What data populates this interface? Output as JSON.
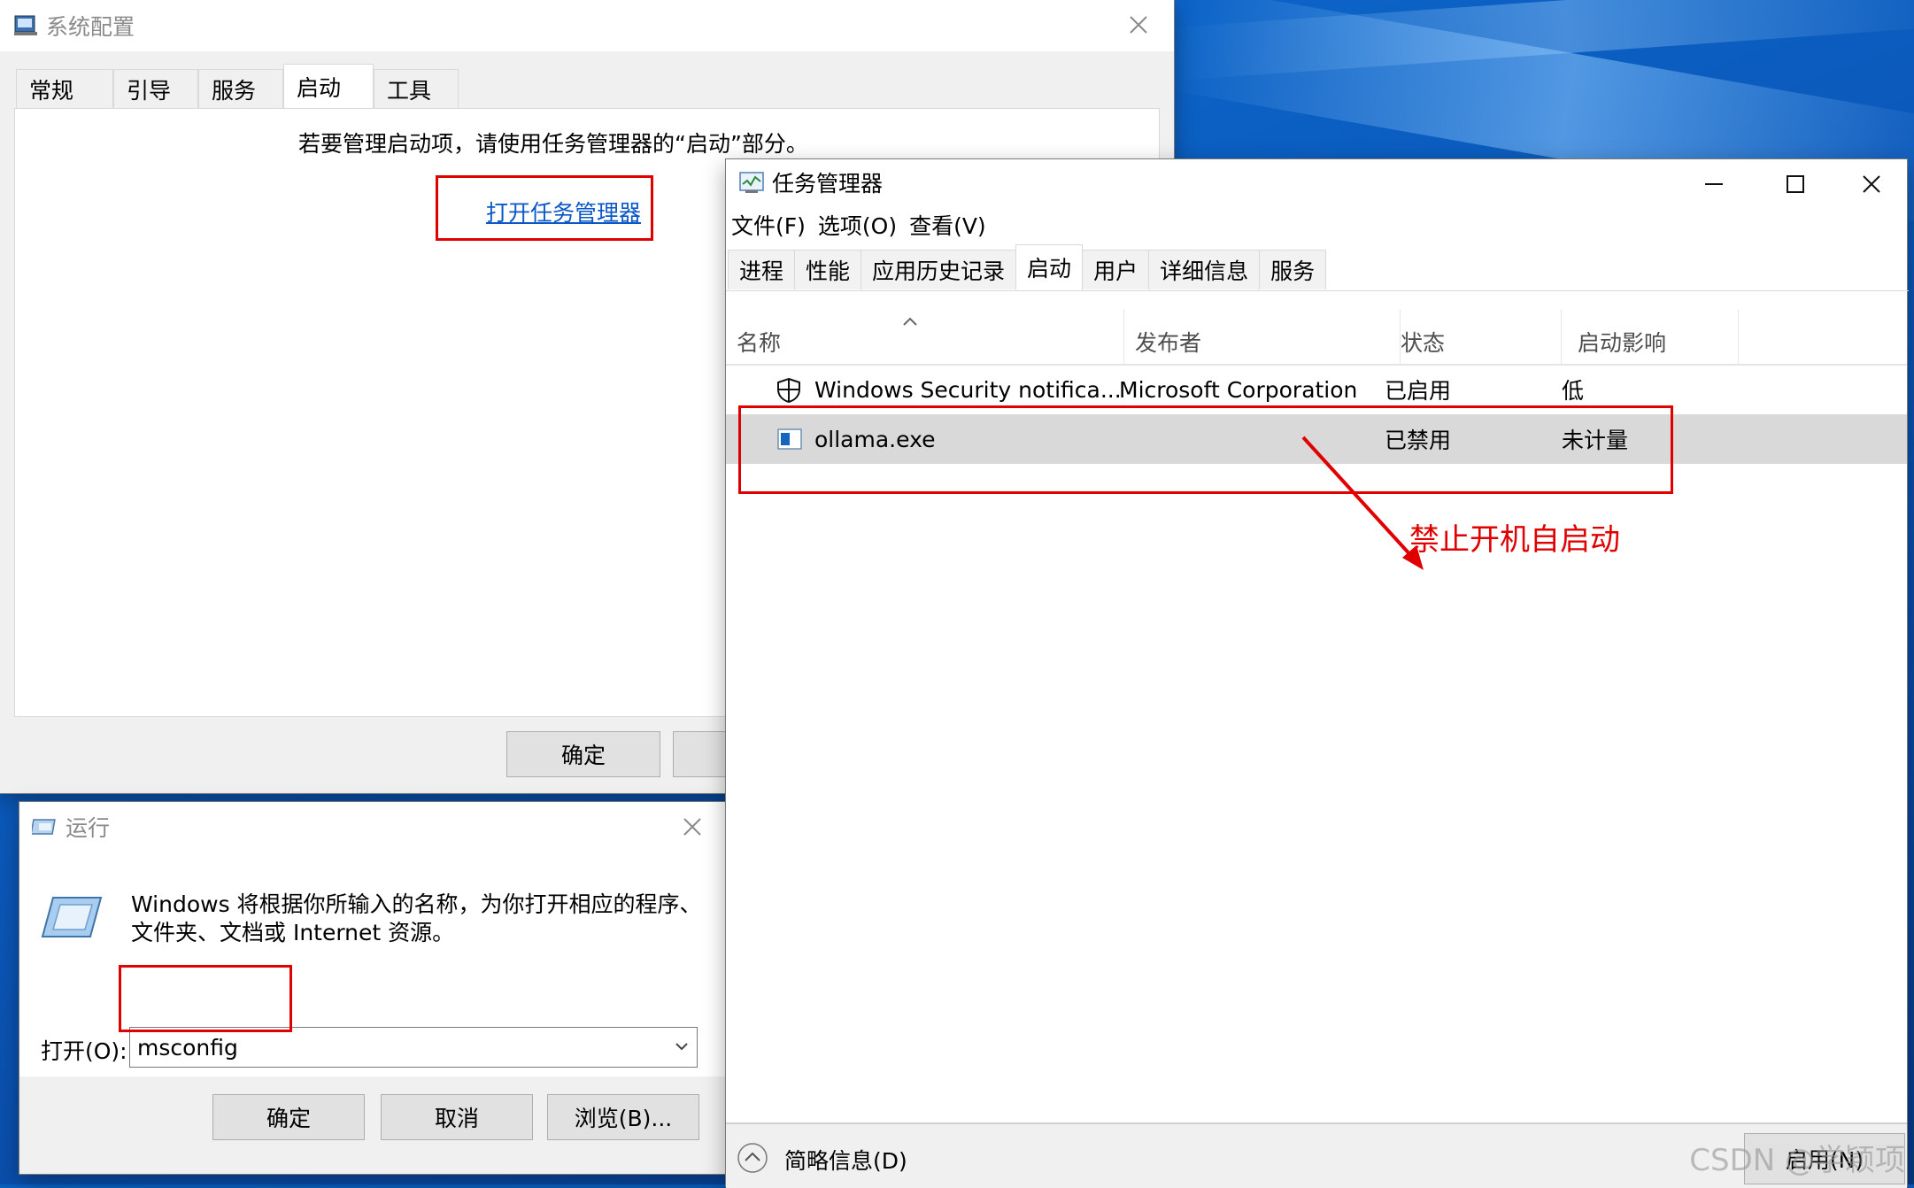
{
  "msconfig": {
    "title": "系统配置",
    "tabs": [
      "常规",
      "引导",
      "服务",
      "启动",
      "工具"
    ],
    "message": "若要管理启动项，请使用任务管理器的“启动”部分。",
    "link": "打开任务管理器",
    "ok": "确定"
  },
  "run": {
    "title": "运行",
    "description_line1": "Windows 将根据你所输入的名称，为你打开相应的程序、",
    "description_line2": "文件夹、文档或 Internet 资源。",
    "open_label": "打开(O):",
    "input_value": "msconfig",
    "ok": "确定",
    "cancel": "取消",
    "browse": "浏览(B)..."
  },
  "taskmgr": {
    "title": "任务管理器",
    "menu": [
      "文件(F)",
      "选项(O)",
      "查看(V)"
    ],
    "tabs": [
      "进程",
      "性能",
      "应用历史记录",
      "启动",
      "用户",
      "详细信息",
      "服务"
    ],
    "columns": {
      "name": "名称",
      "publisher": "发布者",
      "status": "状态",
      "impact": "启动影响"
    },
    "rows": [
      {
        "name": "Windows Security notifica...",
        "publisher": "Microsoft Corporation",
        "status": "已启用",
        "impact": "低"
      },
      {
        "name": "ollama.exe",
        "publisher": "",
        "status": "已禁用",
        "impact": "未计量"
      }
    ],
    "fewer_details": "简略信息(D)",
    "enable_button": "启用(N)"
  },
  "annotation": "禁止开机自启动",
  "watermark": "CSDN @学颖项"
}
